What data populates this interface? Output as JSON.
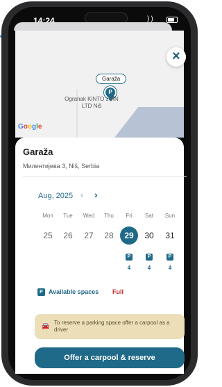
{
  "status_bar": {
    "time": "14:24"
  },
  "map": {
    "pin_label": "Garaža",
    "pin_letter": "P",
    "place_label": "Ogranak KINTO JOIN LTD Niš",
    "attribution": {
      "g1": "G",
      "o1": "o",
      "o2": "o",
      "g2": "g",
      "l": "l",
      "e": "e"
    },
    "close_icon": "×"
  },
  "card": {
    "title": "Garaža",
    "address": "Милентијева 3, Niš, Serbia",
    "calendar": {
      "month": "Aug, 2025",
      "prev_icon": "‹",
      "next_icon": "›",
      "weekdays": [
        "Mon",
        "Tue",
        "Wed",
        "Thu",
        "Fri",
        "Sat",
        "Sun"
      ],
      "days": [
        "25",
        "26",
        "27",
        "28",
        "29",
        "30",
        "31"
      ],
      "selected_day": "29",
      "availability": [
        {
          "badge": "P",
          "count": "4"
        },
        {
          "badge": "P",
          "count": "4"
        },
        {
          "badge": "P",
          "count": "4"
        }
      ]
    },
    "legend": {
      "badge": "P",
      "available": "Available spaces",
      "full": "Full"
    },
    "notice": {
      "icon": "🚘",
      "text": "To reserve a parking space offer a carpool as a driver"
    },
    "cta_label": "Offer a carpool & reserve"
  },
  "colors": {
    "accent": "#1f6a88",
    "full": "#c62828",
    "notice_bg": "#ecdfb8",
    "arrow": "#4a8fc4"
  }
}
